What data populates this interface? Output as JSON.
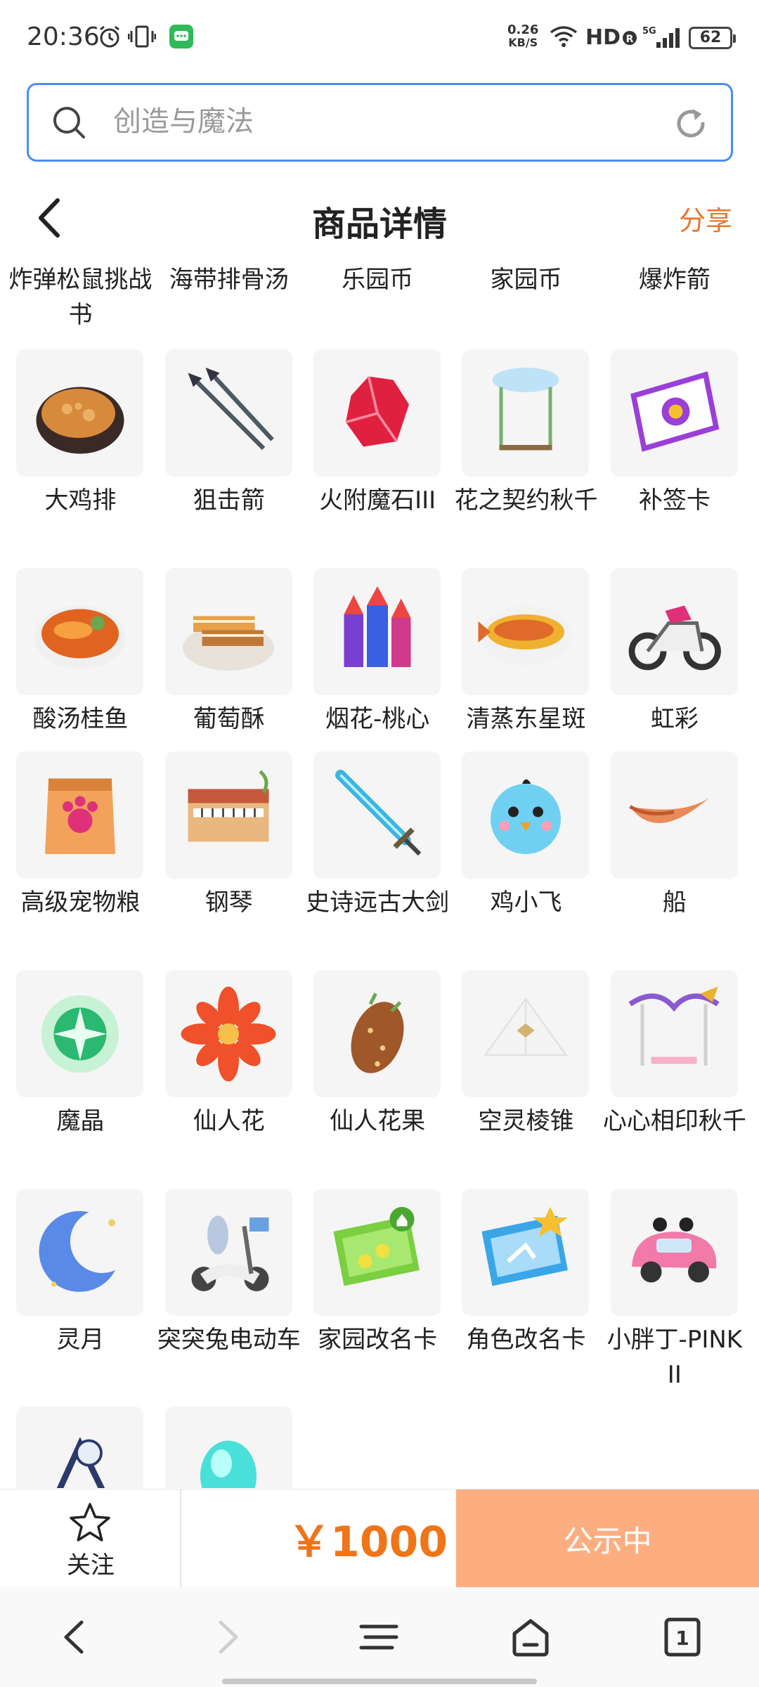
{
  "status_bar": {
    "time": "20:36",
    "net_speed_value": "0.26",
    "net_speed_unit": "KB/S",
    "hd": "HD",
    "battery": "62"
  },
  "search": {
    "placeholder": "创造与魔法"
  },
  "header": {
    "title": "商品详情",
    "share": "分享"
  },
  "top_row": [
    {
      "name": "炸弹松鼠挑战书"
    },
    {
      "name": "海带排骨汤"
    },
    {
      "name": "乐园币"
    },
    {
      "name": "家园币"
    },
    {
      "name": "爆炸箭"
    }
  ],
  "items": [
    {
      "name": "大鸡排",
      "icon": "fried-chicken-icon"
    },
    {
      "name": "狙击箭",
      "icon": "arrows-icon"
    },
    {
      "name": "火附魔石III",
      "icon": "red-crystal-icon"
    },
    {
      "name": "花之契约秋千",
      "icon": "swing-icon"
    },
    {
      "name": "补签卡",
      "icon": "ticket-icon"
    },
    {
      "name": "酸汤桂鱼",
      "icon": "fish-soup-icon"
    },
    {
      "name": "葡萄酥",
      "icon": "pastry-icon"
    },
    {
      "name": "烟花-桃心",
      "icon": "firework-icon"
    },
    {
      "name": "清蒸东星斑",
      "icon": "steamed-fish-icon"
    },
    {
      "name": "虹彩",
      "icon": "motorcycle-icon"
    },
    {
      "name": "高级宠物粮",
      "icon": "pet-food-icon"
    },
    {
      "name": "钢琴",
      "icon": "piano-icon"
    },
    {
      "name": "史诗远古大剑",
      "icon": "sword-icon"
    },
    {
      "name": "鸡小飞",
      "icon": "bird-pet-icon"
    },
    {
      "name": "船",
      "icon": "boat-icon"
    },
    {
      "name": "魔晶",
      "icon": "magic-crystal-icon"
    },
    {
      "name": "仙人花",
      "icon": "flower-icon"
    },
    {
      "name": "仙人花果",
      "icon": "cactus-fruit-icon"
    },
    {
      "name": "空灵棱锥",
      "icon": "pyramid-icon"
    },
    {
      "name": "心心相印秋千",
      "icon": "heart-swing-icon"
    },
    {
      "name": "灵月",
      "icon": "moon-icon"
    },
    {
      "name": "突突兔电动车",
      "icon": "scooter-icon"
    },
    {
      "name": "家园改名卡",
      "icon": "home-rename-card-icon"
    },
    {
      "name": "角色改名卡",
      "icon": "role-rename-card-icon"
    },
    {
      "name": "小胖丁-PINK II",
      "icon": "pink-car-icon"
    },
    {
      "name": "",
      "icon": "toy-icon"
    },
    {
      "name": "",
      "icon": "cyan-orb-icon"
    }
  ],
  "action_bar": {
    "follow": "关注",
    "price": "￥1000",
    "status": "公示中"
  },
  "colors": {
    "accent": "#e8772a",
    "price": "#f07418",
    "status_button": "#fdae81",
    "search_border": "#4a8ef0"
  }
}
